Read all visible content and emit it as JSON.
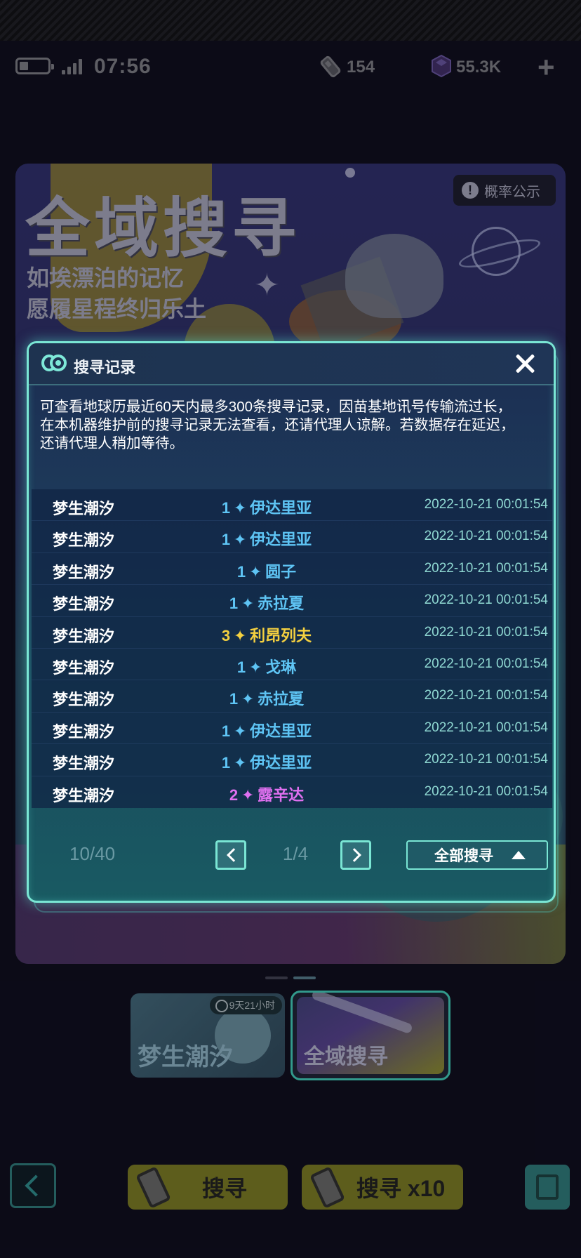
{
  "status_bar": {
    "time": "07:56",
    "resource_ticket": "154",
    "resource_crystal": "55.3K"
  },
  "banner": {
    "title": "全域搜寻",
    "subtitle_line1": "如埃漂泊的记忆",
    "subtitle_line2": "愿履星程终归乐土",
    "probability_button": "概率公示"
  },
  "pool_cards": [
    {
      "title": "梦生潮汐",
      "timer": "9天21小时"
    },
    {
      "title": "全域搜寻"
    }
  ],
  "bottom_bar": {
    "search_once": "搜寻",
    "search_ten": "搜寻 x10"
  },
  "modal": {
    "title": "搜寻记录",
    "description": "可查看地球历最近60天内最多300条搜寻记录，因苗基地讯号传输流过长，\n在本机器维护前的搜寻记录无法查看，还请代理人谅解。若数据存在延迟，\n还请代理人稍加等待。",
    "records": [
      {
        "pool": "梦生潮汐",
        "rarity": "1",
        "name": "伊达里亚",
        "time": "2022-10-21 00:01:54"
      },
      {
        "pool": "梦生潮汐",
        "rarity": "1",
        "name": "伊达里亚",
        "time": "2022-10-21 00:01:54"
      },
      {
        "pool": "梦生潮汐",
        "rarity": "1",
        "name": "圆子",
        "time": "2022-10-21 00:01:54"
      },
      {
        "pool": "梦生潮汐",
        "rarity": "1",
        "name": "赤拉夏",
        "time": "2022-10-21 00:01:54"
      },
      {
        "pool": "梦生潮汐",
        "rarity": "3",
        "name": "利昂列夫",
        "time": "2022-10-21 00:01:54"
      },
      {
        "pool": "梦生潮汐",
        "rarity": "1",
        "name": "戈琳",
        "time": "2022-10-21 00:01:54"
      },
      {
        "pool": "梦生潮汐",
        "rarity": "1",
        "name": "赤拉夏",
        "time": "2022-10-21 00:01:54"
      },
      {
        "pool": "梦生潮汐",
        "rarity": "1",
        "name": "伊达里亚",
        "time": "2022-10-21 00:01:54"
      },
      {
        "pool": "梦生潮汐",
        "rarity": "1",
        "name": "伊达里亚",
        "time": "2022-10-21 00:01:54"
      },
      {
        "pool": "梦生潮汐",
        "rarity": "2",
        "name": "露辛达",
        "time": "2022-10-21 00:01:54"
      }
    ],
    "count": "10/40",
    "page": "1/4",
    "filter_label": "全部搜寻"
  },
  "colors": {
    "modal_border": "#7ae6d4",
    "rarity_1": "#5ec4f4",
    "rarity_2": "#e070f0",
    "rarity_3": "#f4d040",
    "time_text": "#8fd8d2"
  }
}
